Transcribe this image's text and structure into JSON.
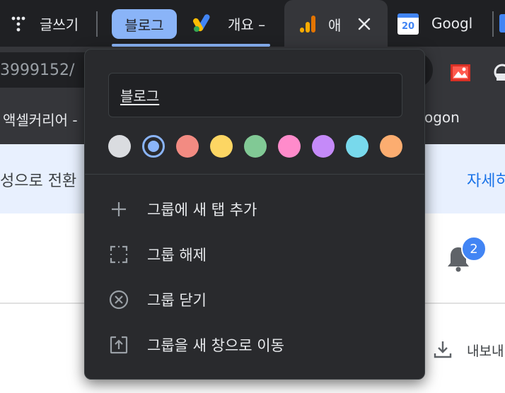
{
  "tabs": {
    "tab1_label": "글쓰기",
    "group_label": "블로그",
    "tab2_label": "개요 –",
    "active_tab_label": "애",
    "tab4_label": "Googl",
    "calendar_day": "20"
  },
  "toolbar": {
    "address_text": "3999152/"
  },
  "bookmarks": {
    "item1": "액셀커리어 -",
    "item2": "ogon"
  },
  "page": {
    "banner_left": "성으로 전환",
    "banner_right": "자세히",
    "notification_count": "2",
    "export_label": "내보내"
  },
  "group_menu": {
    "name_value": "블로그",
    "colors": [
      {
        "name": "grey",
        "hex": "#dadce0"
      },
      {
        "name": "blue",
        "hex": "#8ab4f8",
        "selected": true
      },
      {
        "name": "red",
        "hex": "#f28b82"
      },
      {
        "name": "yellow",
        "hex": "#fdd663"
      },
      {
        "name": "green",
        "hex": "#81c995"
      },
      {
        "name": "pink",
        "hex": "#ff8bcb"
      },
      {
        "name": "purple",
        "hex": "#c58af9"
      },
      {
        "name": "cyan",
        "hex": "#78d9ec"
      },
      {
        "name": "orange",
        "hex": "#fcad70"
      }
    ],
    "items": [
      {
        "label": "그룹에 새 탭 추가",
        "icon": "plus-icon"
      },
      {
        "label": "그룹 해제",
        "icon": "ungroup-icon"
      },
      {
        "label": "그룹 닫기",
        "icon": "close-circle-icon"
      },
      {
        "label": "그룹을 새 창으로 이동",
        "icon": "move-window-icon"
      }
    ]
  }
}
